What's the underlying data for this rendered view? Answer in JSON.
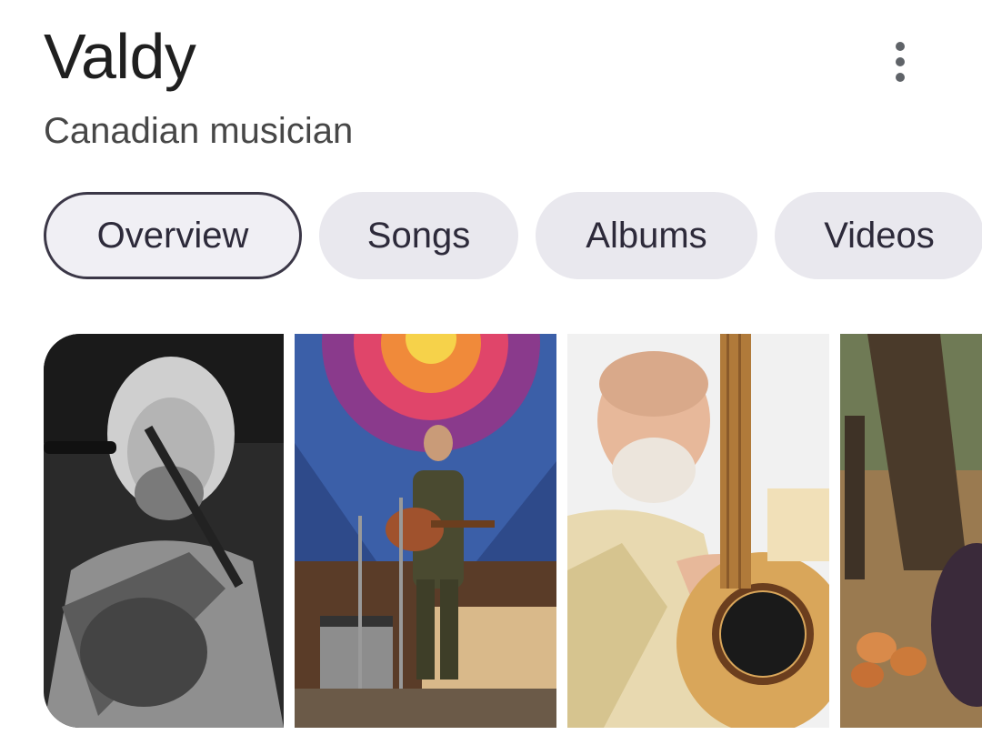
{
  "header": {
    "title": "Valdy",
    "subtitle": "Canadian musician"
  },
  "tabs": [
    {
      "label": "Overview",
      "selected": true
    },
    {
      "label": "Songs",
      "selected": false
    },
    {
      "label": "Albums",
      "selected": false
    },
    {
      "label": "Videos",
      "selected": false
    }
  ],
  "icons": {
    "more": "more-vert-icon"
  },
  "colors": {
    "selected_tab_border": "#3b3747",
    "tab_background": "#e9e8ee",
    "title_text": "#1f1f1f",
    "subtitle_text": "#474747"
  }
}
